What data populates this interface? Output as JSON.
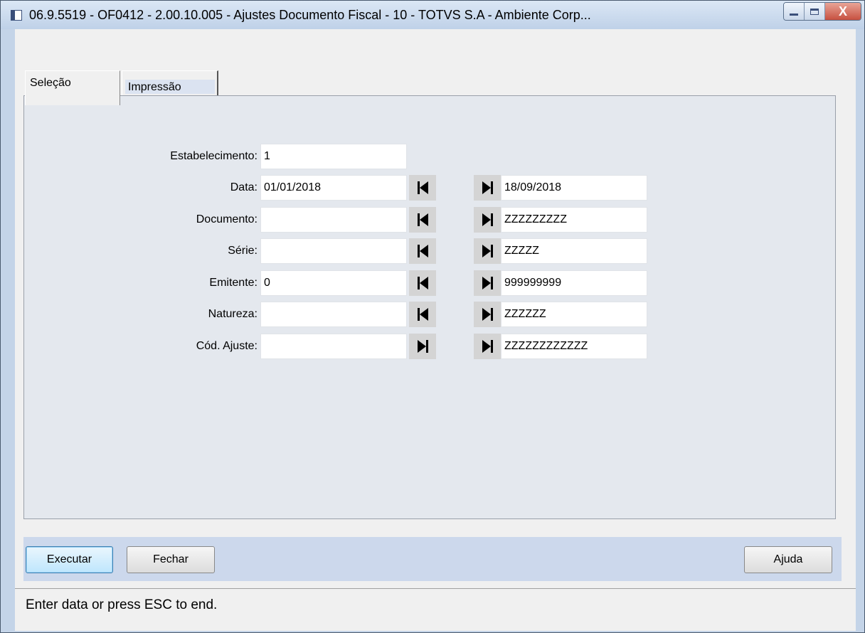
{
  "window": {
    "title": "06.9.5519 - OF0412 - 2.00.10.005 - Ajustes Documento Fiscal - 10 - TOTVS S.A - Ambiente Corp...",
    "close_glyph": "X"
  },
  "tabs": [
    {
      "label": "Seleção",
      "selected": true
    },
    {
      "label": "Impressão",
      "selected": false
    }
  ],
  "form": {
    "estabelecimento": {
      "label": "Estabelecimento:",
      "value": "1"
    },
    "rows": [
      {
        "label": "Data:",
        "from": "01/01/2018",
        "to": "18/09/2018"
      },
      {
        "label": "Documento:",
        "from": "",
        "to": "ZZZZZZZZZ"
      },
      {
        "label": "Série:",
        "from": "",
        "to": "ZZZZZ"
      },
      {
        "label": "Emitente:",
        "from": "0",
        "to": "999999999"
      },
      {
        "label": "Natureza:",
        "from": "",
        "to": "ZZZZZZ"
      },
      {
        "label": "Cód. Ajuste:",
        "from": "",
        "to": "ZZZZZZZZZZZZ"
      }
    ]
  },
  "buttons": {
    "executar": "Executar",
    "fechar": "Fechar",
    "ajuda": "Ajuda"
  },
  "status": "Enter data or press ESC to end."
}
